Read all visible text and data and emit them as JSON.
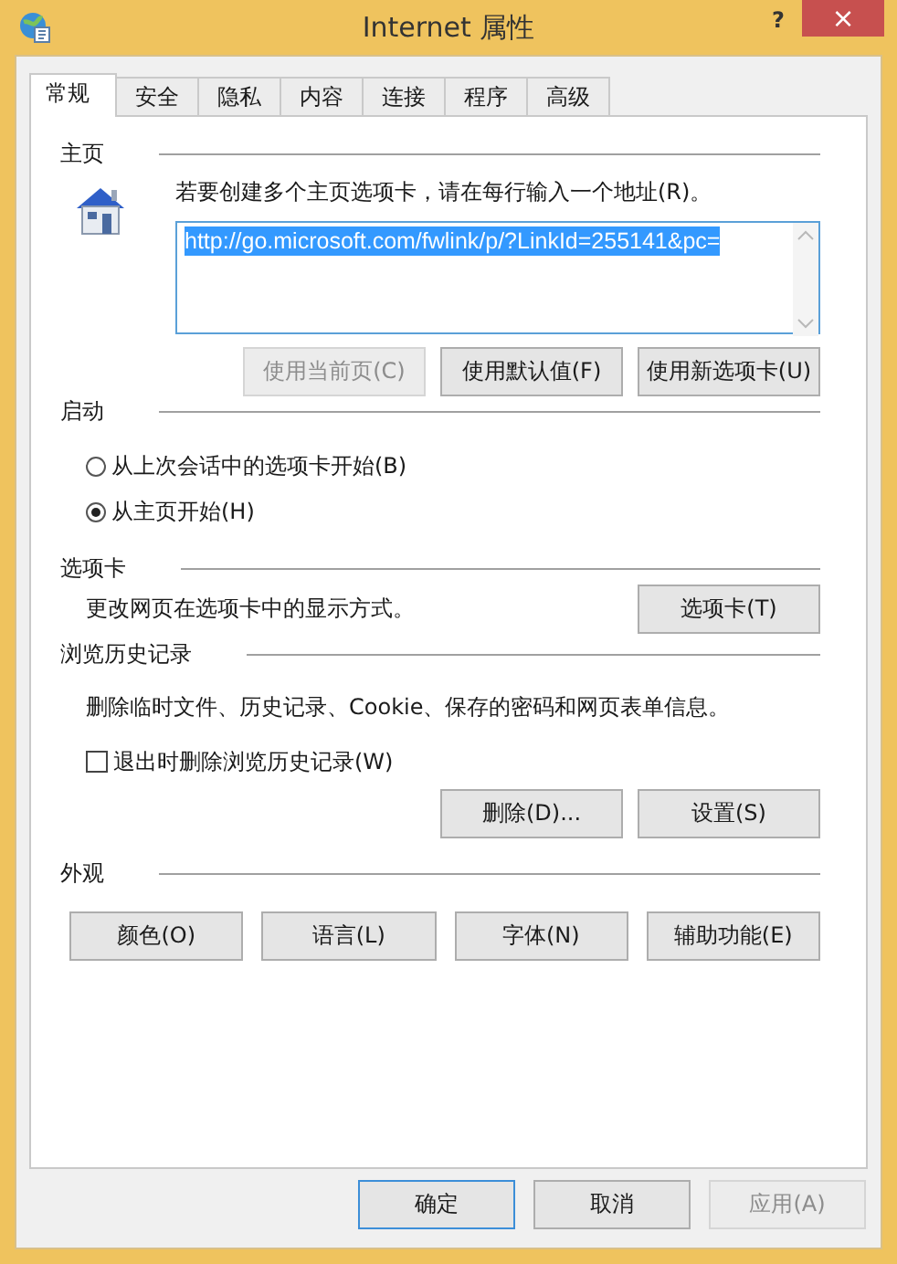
{
  "window": {
    "title": "Internet 属性",
    "help_button": "?",
    "close_button": "×"
  },
  "tabs": [
    {
      "label": "常规",
      "selected": true
    },
    {
      "label": "安全",
      "selected": false
    },
    {
      "label": "隐私",
      "selected": false
    },
    {
      "label": "内容",
      "selected": false
    },
    {
      "label": "连接",
      "selected": false
    },
    {
      "label": "程序",
      "selected": false
    },
    {
      "label": "高级",
      "selected": false
    }
  ],
  "home_page": {
    "heading": "主页",
    "instruction": "若要创建多个主页选项卡，请在每行输入一个地址(R)。",
    "address": {
      "value": "http://go.microsoft.com/fwlink/p/?LinkId=255141&pc=",
      "selected": true
    },
    "buttons": [
      {
        "label": "使用当前页(C)",
        "disabled": true
      },
      {
        "label": "使用默认值(F)",
        "disabled": false
      },
      {
        "label": "使用新选项卡(U)",
        "disabled": false
      }
    ]
  },
  "startup": {
    "heading": "启动",
    "options": [
      {
        "label": "从上次会话中的选项卡开始(B)",
        "selected": false
      },
      {
        "label": "从主页开始(H)",
        "selected": true
      }
    ]
  },
  "tabs_section": {
    "heading": "选项卡",
    "description": "更改网页在选项卡中的显示方式。",
    "button": "选项卡(T)"
  },
  "history": {
    "heading": "浏览历史记录",
    "description": "删除临时文件、历史记录、Cookie、保存的密码和网页表单信息。",
    "checkbox": {
      "label": "退出时删除浏览历史记录(W)",
      "checked": false
    },
    "buttons": [
      {
        "label": "删除(D)...",
        "disabled": false
      },
      {
        "label": "设置(S)",
        "disabled": false
      }
    ]
  },
  "appearance": {
    "heading": "外观",
    "buttons": [
      {
        "label": "颜色(O)",
        "disabled": false
      },
      {
        "label": "语言(L)",
        "disabled": false
      },
      {
        "label": "字体(N)",
        "disabled": false
      },
      {
        "label": "辅助功能(E)",
        "disabled": false
      }
    ]
  },
  "footer_buttons": [
    {
      "label": "确定",
      "default": true,
      "disabled": false
    },
    {
      "label": "取消",
      "default": false,
      "disabled": false
    },
    {
      "label": "应用(A)",
      "default": false,
      "disabled": true
    }
  ]
}
